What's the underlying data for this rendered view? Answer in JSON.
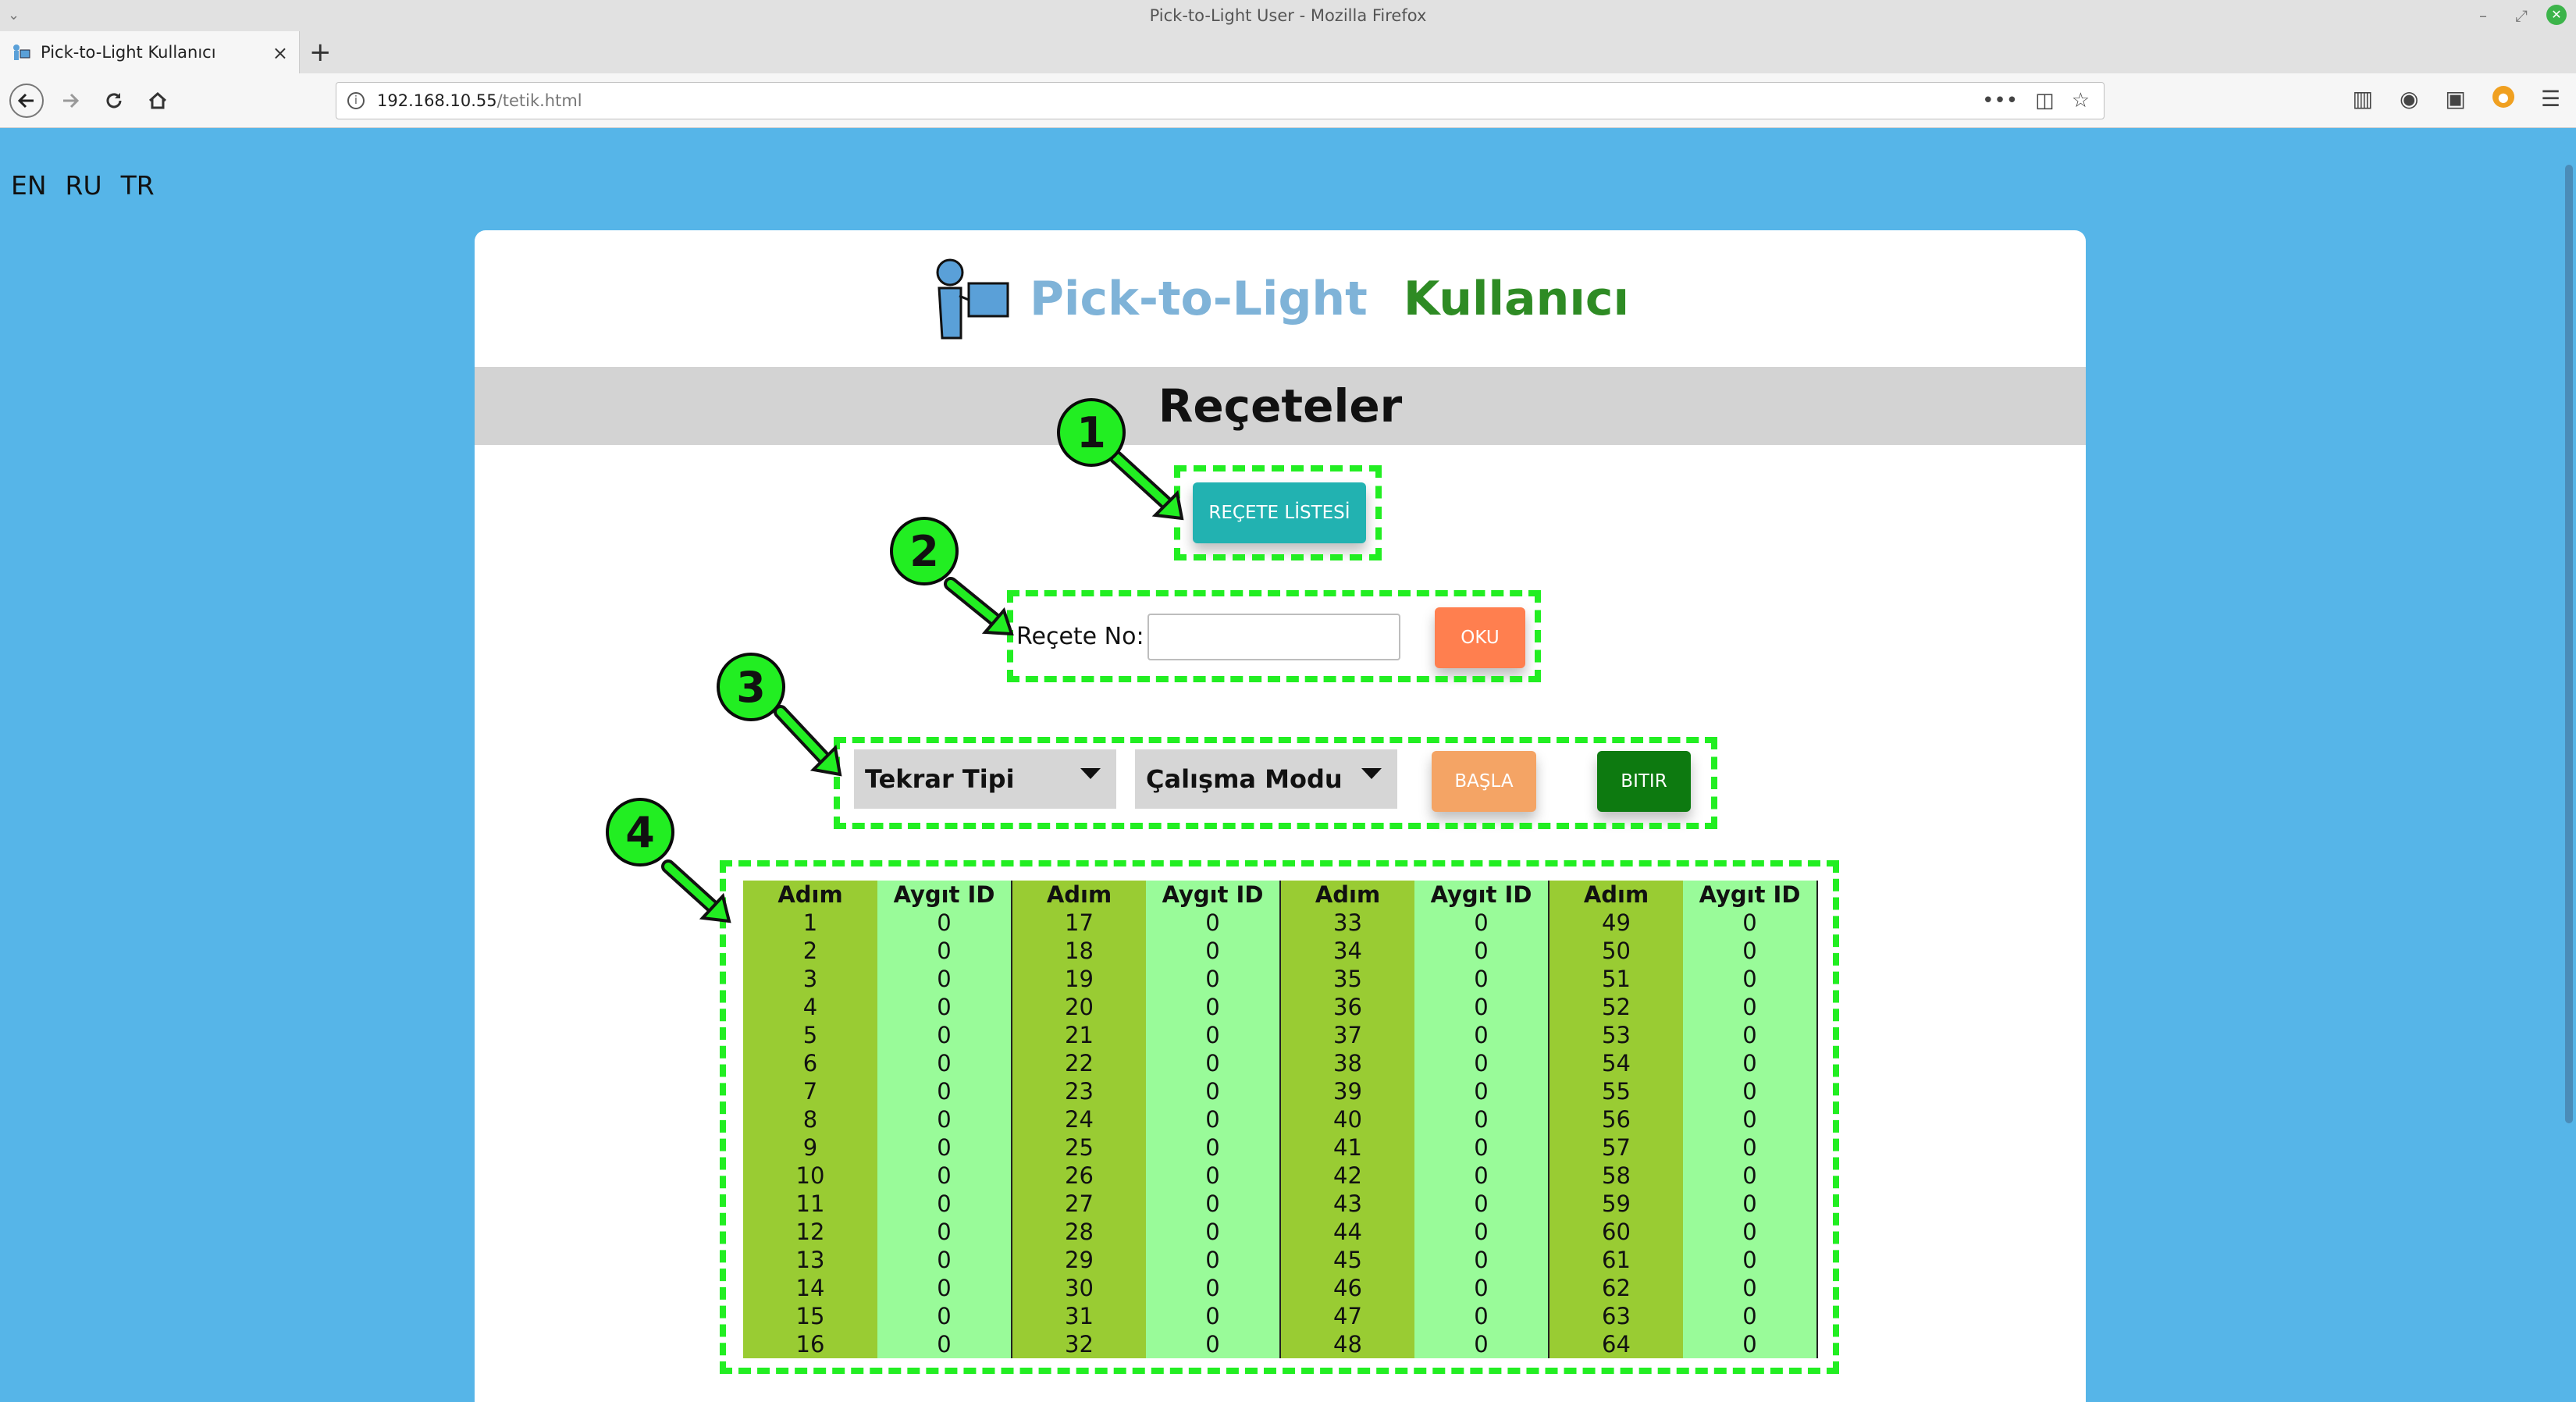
{
  "window": {
    "title": "Pick-to-Light User - Mozilla Firefox"
  },
  "tab": {
    "title": "Pick-to-Light Kullanıcı",
    "close": "×",
    "new_tab": "+"
  },
  "url": {
    "host": "192.168.10.55",
    "path": "/tetik.html"
  },
  "languages": [
    "EN",
    "RU",
    "TR"
  ],
  "brand": {
    "part1": "Pick-to-Light",
    "part2": "Kullanıcı"
  },
  "section_title": "Reçeteler",
  "recipe_list_button": "REÇETE LİSTESİ",
  "recipe_no_label": "Reçete No:",
  "recipe_no_value": "",
  "read_button": "OKU",
  "repeat_type_select": "Tekrar Tipi",
  "work_mode_select": "Çalışma Modu",
  "start_button": "BAŞLA",
  "stop_button": "BITIR",
  "table": {
    "headers": [
      "Adım",
      "Aygıt ID",
      "Adım",
      "Aygıt ID",
      "Adım",
      "Aygıt ID",
      "Adım",
      "Aygıt ID"
    ],
    "rows": [
      [
        "1",
        "0",
        "17",
        "0",
        "33",
        "0",
        "49",
        "0"
      ],
      [
        "2",
        "0",
        "18",
        "0",
        "34",
        "0",
        "50",
        "0"
      ],
      [
        "3",
        "0",
        "19",
        "0",
        "35",
        "0",
        "51",
        "0"
      ],
      [
        "4",
        "0",
        "20",
        "0",
        "36",
        "0",
        "52",
        "0"
      ],
      [
        "5",
        "0",
        "21",
        "0",
        "37",
        "0",
        "53",
        "0"
      ],
      [
        "6",
        "0",
        "22",
        "0",
        "38",
        "0",
        "54",
        "0"
      ],
      [
        "7",
        "0",
        "23",
        "0",
        "39",
        "0",
        "55",
        "0"
      ],
      [
        "8",
        "0",
        "24",
        "0",
        "40",
        "0",
        "56",
        "0"
      ],
      [
        "9",
        "0",
        "25",
        "0",
        "41",
        "0",
        "57",
        "0"
      ],
      [
        "10",
        "0",
        "26",
        "0",
        "42",
        "0",
        "58",
        "0"
      ],
      [
        "11",
        "0",
        "27",
        "0",
        "43",
        "0",
        "59",
        "0"
      ],
      [
        "12",
        "0",
        "28",
        "0",
        "44",
        "0",
        "60",
        "0"
      ],
      [
        "13",
        "0",
        "29",
        "0",
        "45",
        "0",
        "61",
        "0"
      ],
      [
        "14",
        "0",
        "30",
        "0",
        "46",
        "0",
        "62",
        "0"
      ],
      [
        "15",
        "0",
        "31",
        "0",
        "47",
        "0",
        "63",
        "0"
      ],
      [
        "16",
        "0",
        "32",
        "0",
        "48",
        "0",
        "64",
        "0"
      ]
    ]
  },
  "callouts": [
    "1",
    "2",
    "3",
    "4"
  ],
  "colors": {
    "page_bg": "#56b5e8",
    "callout": "#22ee22",
    "list_button": "#22b2b1",
    "read_button": "#ff7f4f",
    "start_button": "#f4a465",
    "stop_button": "#0d7a10",
    "step_col": "#99cc33",
    "id_col": "#99fb99"
  }
}
